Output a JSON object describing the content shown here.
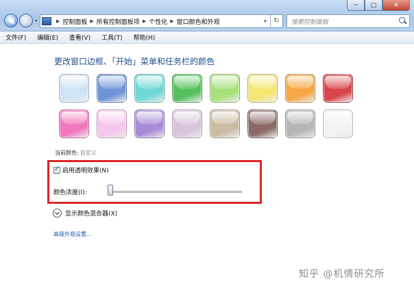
{
  "window": {
    "minimize": "─",
    "maximize": "□",
    "close": "✕"
  },
  "nav": {
    "back": "◀",
    "forward": "▶",
    "history": "▾"
  },
  "breadcrumb": [
    "控制面板",
    "所有控制面板项",
    "个性化",
    "窗口颜色和外观"
  ],
  "address": {
    "dropdown": "▾",
    "refresh": "↻"
  },
  "search": {
    "placeholder": "搜索控制面板"
  },
  "menu": [
    "文件(F)",
    "编辑(E)",
    "查看(V)",
    "工具(T)",
    "帮助(H)"
  ],
  "main": {
    "heading": "更改窗口边框、「开始」菜单和任务栏的颜色",
    "swatch_colors": [
      "#cfe3f7",
      "#6f95d6",
      "#6fd8d6",
      "#56c05e",
      "#a8e07a",
      "#f6e573",
      "#f4a742",
      "#d8464a",
      "#f277bf",
      "#f6c6ee",
      "#a88bd6",
      "#d9c4dc",
      "#c9bca2",
      "#8a6a66",
      "#b6b6b6",
      "#f2f2f2"
    ],
    "current_color_label": "当前颜色:",
    "current_color_value": "自定义",
    "transparency_label": "启用透明效果(N)",
    "transparency_checked": true,
    "intensity_label": "颜色浓度(I):",
    "intensity_level": 0.0,
    "mixer_label": "显示颜色混合器(X)",
    "advanced_link": "高级外观设置..."
  },
  "watermark": "知乎 @机情研究所",
  "colors": {
    "highlight_box": "#d9262a",
    "heading": "#1e4e8c",
    "link": "#1a5aa8"
  }
}
